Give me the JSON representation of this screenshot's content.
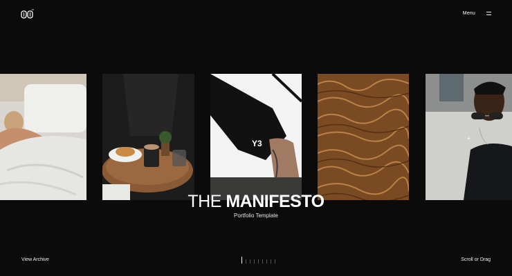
{
  "header": {
    "logo_icon": "brand-logo-icon",
    "logo_tm": "™",
    "menu_label": "Menu",
    "menu_icon": "hamburger-icon"
  },
  "gallery": {
    "items": [
      {
        "name": "photo-person-in-bed"
      },
      {
        "name": "photo-coffee-croissant-table"
      },
      {
        "name": "photo-y3-shoulder-bag"
      },
      {
        "name": "photo-brown-fur-texture"
      },
      {
        "name": "photo-man-with-sunglasses"
      }
    ],
    "bag_label": "Y3"
  },
  "hero": {
    "title_light": "THE",
    "title_bold": "MANIFESTO",
    "subtitle": "Portfolio Template"
  },
  "footer": {
    "view_archive": "View Archive",
    "scroll_hint": "Scroll or Drag",
    "progress": {
      "total": 9,
      "current": 1
    }
  },
  "colors": {
    "background": "#0b0b0b",
    "text": "#ffffff"
  }
}
